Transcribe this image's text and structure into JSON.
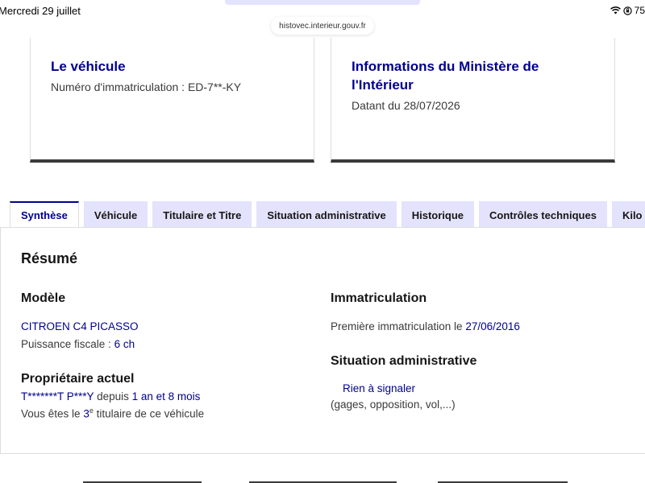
{
  "status_bar": {
    "time": "Mercredi 29 juillet",
    "battery": "75"
  },
  "browser": {
    "url": "histovec.interieur.gouv.fr"
  },
  "vehicle_card": {
    "title": "Le véhicule",
    "plate_label": "Numéro d'immatriculation : ED-7**-KY"
  },
  "ministry_card": {
    "title_line1": "Informations du Ministère de",
    "title_line2": "l'Intérieur",
    "date_text": "Datant du 28/07/2026"
  },
  "tabs": [
    {
      "label": "Synthèse",
      "active": true
    },
    {
      "label": "Véhicule",
      "active": false
    },
    {
      "label": "Titulaire et Titre",
      "active": false
    },
    {
      "label": "Situation administrative",
      "active": false
    },
    {
      "label": "Historique",
      "active": false
    },
    {
      "label": "Contrôles techniques",
      "active": false
    },
    {
      "label": "Kilo",
      "active": false
    }
  ],
  "summary": {
    "heading": "Résumé",
    "model": {
      "heading": "Modèle",
      "name": "CITROEN C4 PICASSO",
      "power_label": "Puissance fiscale : ",
      "power_value": "6 ch"
    },
    "owner": {
      "heading": "Propriétaire actuel",
      "name": "T*******T P***Y",
      "since_label": " depuis ",
      "since_value": "1 an et 8 mois",
      "rank_prefix": "Vous êtes le ",
      "rank_value": "3",
      "rank_sup": "e",
      "rank_suffix": " titulaire de ce véhicule"
    },
    "registration": {
      "heading": "Immatriculation",
      "first_label": "Première immatriculation le ",
      "first_date": "27/06/2016"
    },
    "admin": {
      "heading": "Situation administrative",
      "status": "Rien à signaler",
      "details": "(gages, opposition, vol,...)"
    }
  },
  "colors": {
    "primary": "#000091",
    "tab_bg": "#e3e3fd",
    "text": "#161616",
    "muted": "#3a3a3a"
  }
}
